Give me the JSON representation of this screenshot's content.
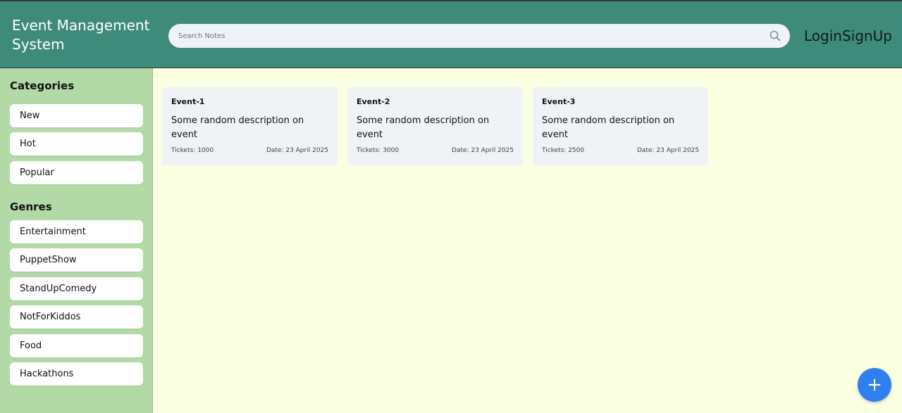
{
  "header": {
    "brand_line1": "Event Management",
    "brand_line2": "System",
    "search_placeholder": "Search Notes",
    "search_icon": "search-icon",
    "login_label": "Login",
    "signup_label": "SignUp"
  },
  "sidebar": {
    "categories_title": "Categories",
    "categories": [
      "New",
      "Hot",
      "Popular"
    ],
    "genres_title": "Genres",
    "genres": [
      "Entertainment",
      "PuppetShow",
      "StandUpComedy",
      "NotForKiddos",
      "Food",
      "Hackathons"
    ]
  },
  "events": [
    {
      "title": "Event-1",
      "description": "Some random description on event",
      "tickets": "Tickets: 1000",
      "date": "Date: 23 April 2025"
    },
    {
      "title": "Event-2",
      "description": "Some random description on event",
      "tickets": "Tickets: 3000",
      "date": "Date: 23 April 2025"
    },
    {
      "title": "Event-3",
      "description": "Some random description on event",
      "tickets": "Tickets: 2500",
      "date": "Date: 23 April 2025"
    }
  ],
  "fab": {
    "label": "+",
    "icon": "plus-icon"
  },
  "colors": {
    "header_bg": "#3f8b7b",
    "sidebar_bg": "#b3d9a7",
    "content_bg": "#faffe2",
    "card_bg": "#eff3f6",
    "fab_bg": "#2f7ff1"
  }
}
